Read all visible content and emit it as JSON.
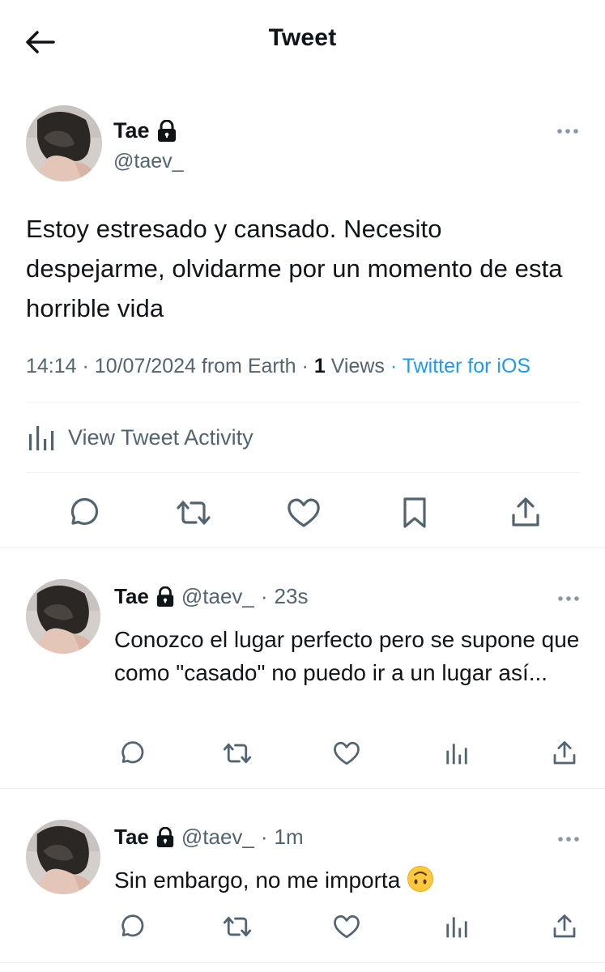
{
  "header": {
    "title": "Tweet",
    "back_icon": "arrow-left-icon"
  },
  "main_tweet": {
    "author_name": "Tae",
    "author_handle": "@taev_",
    "protected_icon": "lock-icon",
    "text": "Estoy estresado y cansado. Necesito despejarme, olvidarme por un momento de esta horrible vida",
    "time": "14:14",
    "date": "10/07/2024",
    "location": "from Earth",
    "sep": "·",
    "views_count": "1",
    "views_label": "Views",
    "source": "Twitter for iOS",
    "activity_label": "View Tweet Activity",
    "actions": [
      "reply-icon",
      "retweet-icon",
      "like-icon",
      "bookmark-icon",
      "share-icon"
    ]
  },
  "replies": [
    {
      "author_name": "Tae",
      "author_handle": "@taev_",
      "dot": "·",
      "time": "23s",
      "text": "Conozco el lugar perfecto pero se supone que como \"casado\" no puedo ir a un lugar así..."
    },
    {
      "author_name": "Tae",
      "author_handle": "@taev_",
      "dot": "·",
      "time": "1m",
      "text": "Sin embargo, no me importa",
      "emoji": "upside-down-face"
    }
  ],
  "colors": {
    "text": "#0f1419",
    "secondary": "#536471",
    "link": "#1d9bf0",
    "divider": "#eff3f4"
  }
}
